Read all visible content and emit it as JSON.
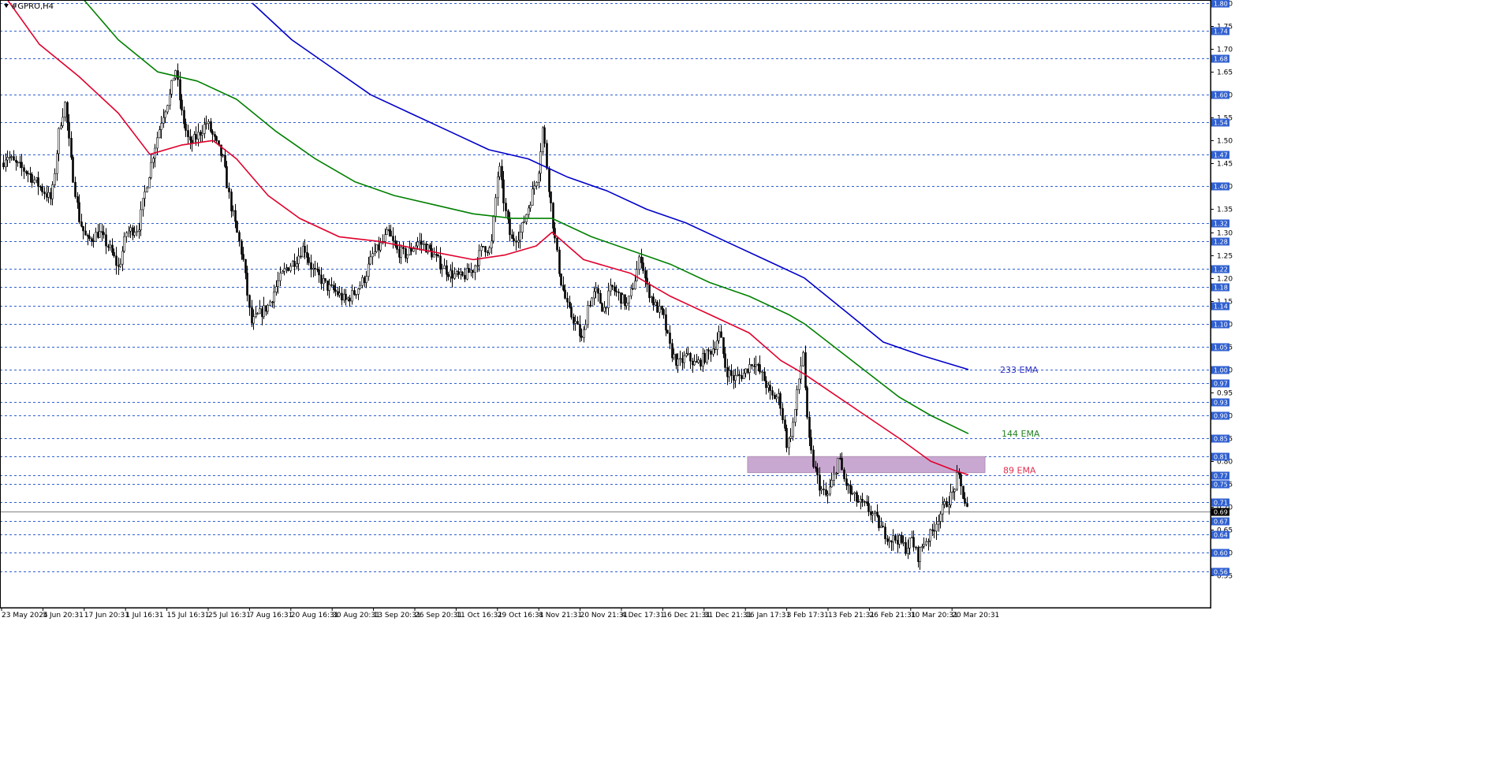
{
  "chart_data": {
    "type": "candlestick",
    "title": "#GPRO,H4",
    "ylim": [
      0.53,
      1.8
    ],
    "y_ticks": [
      0.55,
      0.6,
      0.65,
      0.7,
      0.75,
      0.8,
      0.85,
      0.9,
      0.95,
      1.0,
      1.05,
      1.1,
      1.15,
      1.2,
      1.25,
      1.3,
      1.35,
      1.4,
      1.45,
      1.5,
      1.55,
      1.6,
      1.65,
      1.7,
      1.75,
      1.8
    ],
    "level_lines": [
      0.56,
      0.6,
      0.64,
      0.67,
      0.71,
      0.75,
      0.77,
      0.81,
      0.85,
      0.9,
      0.93,
      0.97,
      1.0,
      1.05,
      1.1,
      1.14,
      1.18,
      1.22,
      1.28,
      1.32,
      1.4,
      1.47,
      1.54,
      1.6,
      1.68,
      1.74,
      1.8
    ],
    "current_price": 0.69,
    "x_labels": [
      "23 May 2024",
      "5 Jun 20:31",
      "17 Jun 20:31",
      "1 Jul 16:31",
      "15 Jul 16:31",
      "25 Jul 16:31",
      "7 Aug 16:31",
      "20 Aug 16:31",
      "30 Aug 20:31",
      "13 Sep 20:31",
      "26 Sep 20:31",
      "11 Oct 16:31",
      "29 Oct 16:31",
      "8 Nov 21:31",
      "20 Nov 21:31",
      "4 Dec 17:31",
      "16 Dec 21:31",
      "31 Dec 21:31",
      "16 Jan 17:31",
      "3 Feb 17:31",
      "13 Feb 21:31",
      "26 Feb 21:31",
      "10 Mar 20:31",
      "20 Mar 20:31"
    ],
    "price_path": [
      [
        0,
        1.44
      ],
      [
        8,
        1.47
      ],
      [
        18,
        1.45
      ],
      [
        35,
        1.43
      ],
      [
        50,
        1.4
      ],
      [
        65,
        1.37
      ],
      [
        75,
        1.53
      ],
      [
        82,
        1.58
      ],
      [
        90,
        1.45
      ],
      [
        100,
        1.33
      ],
      [
        110,
        1.28
      ],
      [
        125,
        1.3
      ],
      [
        140,
        1.26
      ],
      [
        150,
        1.22
      ],
      [
        160,
        1.3
      ],
      [
        175,
        1.31
      ],
      [
        185,
        1.4
      ],
      [
        195,
        1.48
      ],
      [
        205,
        1.55
      ],
      [
        215,
        1.6
      ],
      [
        222,
        1.66
      ],
      [
        230,
        1.56
      ],
      [
        240,
        1.49
      ],
      [
        250,
        1.51
      ],
      [
        262,
        1.54
      ],
      [
        272,
        1.5
      ],
      [
        282,
        1.46
      ],
      [
        292,
        1.36
      ],
      [
        300,
        1.3
      ],
      [
        308,
        1.24
      ],
      [
        318,
        1.1
      ],
      [
        328,
        1.12
      ],
      [
        340,
        1.14
      ],
      [
        352,
        1.19
      ],
      [
        362,
        1.22
      ],
      [
        375,
        1.24
      ],
      [
        385,
        1.27
      ],
      [
        395,
        1.22
      ],
      [
        405,
        1.2
      ],
      [
        415,
        1.18
      ],
      [
        425,
        1.17
      ],
      [
        438,
        1.15
      ],
      [
        450,
        1.17
      ],
      [
        462,
        1.2
      ],
      [
        472,
        1.25
      ],
      [
        482,
        1.27
      ],
      [
        492,
        1.3
      ],
      [
        502,
        1.26
      ],
      [
        515,
        1.25
      ],
      [
        530,
        1.28
      ],
      [
        545,
        1.26
      ],
      [
        558,
        1.23
      ],
      [
        570,
        1.21
      ],
      [
        585,
        1.2
      ],
      [
        600,
        1.22
      ],
      [
        612,
        1.27
      ],
      [
        622,
        1.26
      ],
      [
        632,
        1.45
      ],
      [
        640,
        1.35
      ],
      [
        648,
        1.28
      ],
      [
        660,
        1.3
      ],
      [
        672,
        1.37
      ],
      [
        682,
        1.43
      ],
      [
        688,
        1.53
      ],
      [
        695,
        1.41
      ],
      [
        702,
        1.3
      ],
      [
        710,
        1.2
      ],
      [
        720,
        1.13
      ],
      [
        730,
        1.1
      ],
      [
        738,
        1.06
      ],
      [
        745,
        1.14
      ],
      [
        755,
        1.17
      ],
      [
        765,
        1.13
      ],
      [
        775,
        1.18
      ],
      [
        785,
        1.16
      ],
      [
        795,
        1.14
      ],
      [
        805,
        1.2
      ],
      [
        812,
        1.25
      ],
      [
        820,
        1.18
      ],
      [
        830,
        1.14
      ],
      [
        840,
        1.12
      ],
      [
        850,
        1.04
      ],
      [
        860,
        1.01
      ],
      [
        870,
        1.03
      ],
      [
        882,
        1.01
      ],
      [
        895,
        1.03
      ],
      [
        905,
        1.05
      ],
      [
        912,
        1.08
      ],
      [
        920,
        1.0
      ],
      [
        930,
        0.98
      ],
      [
        942,
        0.99
      ],
      [
        955,
        1.02
      ],
      [
        968,
        0.98
      ],
      [
        978,
        0.94
      ],
      [
        988,
        0.94
      ],
      [
        998,
        0.83
      ],
      [
        1006,
        0.89
      ],
      [
        1012,
        0.97
      ],
      [
        1018,
        1.04
      ],
      [
        1024,
        0.86
      ],
      [
        1030,
        0.8
      ],
      [
        1040,
        0.74
      ],
      [
        1048,
        0.72
      ],
      [
        1056,
        0.76
      ],
      [
        1063,
        0.81
      ],
      [
        1070,
        0.76
      ],
      [
        1078,
        0.73
      ],
      [
        1088,
        0.71
      ],
      [
        1098,
        0.7
      ],
      [
        1108,
        0.68
      ],
      [
        1118,
        0.65
      ],
      [
        1128,
        0.63
      ],
      [
        1138,
        0.63
      ],
      [
        1148,
        0.61
      ],
      [
        1156,
        0.63
      ],
      [
        1163,
        0.59
      ],
      [
        1170,
        0.62
      ],
      [
        1180,
        0.64
      ],
      [
        1190,
        0.68
      ],
      [
        1200,
        0.71
      ],
      [
        1208,
        0.73
      ],
      [
        1214,
        0.77
      ],
      [
        1220,
        0.73
      ],
      [
        1227,
        0.69
      ]
    ],
    "series": [
      {
        "name": "89 EMA",
        "color": "#e0002c",
        "x": [
          0,
          50,
          100,
          150,
          190,
          230,
          270,
          300,
          340,
          380,
          430,
          480,
          540,
          600,
          640,
          680,
          700,
          740,
          800,
          850,
          900,
          950,
          990,
          1020,
          1080,
          1140,
          1180,
          1210,
          1228
        ],
        "values": [
          1.83,
          1.71,
          1.64,
          1.56,
          1.47,
          1.49,
          1.5,
          1.46,
          1.38,
          1.33,
          1.29,
          1.28,
          1.26,
          1.24,
          1.25,
          1.27,
          1.3,
          1.24,
          1.21,
          1.16,
          1.12,
          1.08,
          1.02,
          0.99,
          0.92,
          0.85,
          0.8,
          0.78,
          0.77
        ]
      },
      {
        "name": "144 EMA",
        "color": "#008000",
        "x": [
          100,
          150,
          200,
          250,
          300,
          350,
          400,
          450,
          500,
          550,
          600,
          650,
          700,
          750,
          800,
          850,
          900,
          950,
          1000,
          1020,
          1080,
          1140,
          1180,
          1228
        ],
        "values": [
          1.82,
          1.72,
          1.65,
          1.63,
          1.59,
          1.52,
          1.46,
          1.41,
          1.38,
          1.36,
          1.34,
          1.33,
          1.33,
          1.29,
          1.26,
          1.23,
          1.19,
          1.16,
          1.12,
          1.1,
          1.02,
          0.94,
          0.9,
          0.86
        ]
      },
      {
        "name": "233 EMA",
        "color": "#0000c8",
        "x": [
          320,
          370,
          420,
          470,
          520,
          570,
          620,
          670,
          720,
          770,
          820,
          870,
          920,
          970,
          1020,
          1070,
          1120,
          1170,
          1228
        ],
        "values": [
          1.8,
          1.72,
          1.66,
          1.6,
          1.56,
          1.52,
          1.48,
          1.46,
          1.42,
          1.39,
          1.35,
          1.32,
          1.28,
          1.24,
          1.2,
          1.13,
          1.06,
          1.03,
          1.0
        ]
      }
    ],
    "zone": {
      "x_start": 948,
      "x_end": 1249,
      "y_low": 0.775,
      "y_high": 0.81,
      "color": "#c8a8d0"
    },
    "annotations": [
      {
        "text": "233 EMA",
        "color": "#3030c0",
        "x": 1268,
        "y": 1.0
      },
      {
        "text": "144 EMA",
        "color": "#208020",
        "x": 1270,
        "y": 0.86
      },
      {
        "text": "89 EMA",
        "color": "#e03050",
        "x": 1272,
        "y": 0.78
      }
    ],
    "grid": true,
    "legend": "inline-right"
  }
}
